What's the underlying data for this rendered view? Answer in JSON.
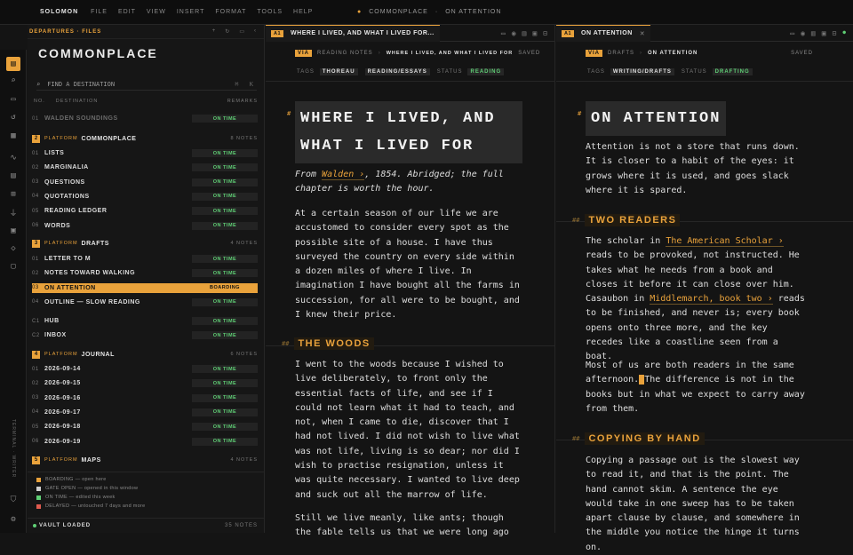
{
  "menubar": {
    "brand": "SOLOMON",
    "items": [
      "FILE",
      "EDIT",
      "VIEW",
      "INSERT",
      "FORMAT",
      "TOOLS",
      "HELP"
    ],
    "center_left": "COMMONPLACE",
    "center_sep": "·",
    "center_right": "ON ATTENTION"
  },
  "rail": {
    "icons": [
      "files-icon",
      "search-icon",
      "inbox-icon",
      "history-icon",
      "grid-icon",
      "activity-icon",
      "table-icon",
      "plugins-icon",
      "plug-icon",
      "archive-icon",
      "tag-icon",
      "calendar-icon",
      "shield-icon",
      "settings-icon"
    ],
    "vertical_label": "TERMINAL · WRITER"
  },
  "sidebar": {
    "header": "DEPARTURES · FILES",
    "title": "COMMONPLACE",
    "search_placeholder": "FIND A DESTINATION",
    "search_kbd": "⌘ K",
    "col_no": "NO.",
    "col_dest": "DESTINATION",
    "col_remarks": "REMARKS",
    "faded_row": {
      "num": "01",
      "name": "WALDEN SOUNDINGS",
      "status": "ON TIME"
    },
    "platforms": [
      {
        "badge": "2",
        "kw": "PLATFORM",
        "name": "COMMONPLACE",
        "count": "8 NOTES"
      },
      {
        "badge": "3",
        "kw": "PLATFORM",
        "name": "DRAFTS",
        "count": "4 NOTES"
      },
      {
        "badge": "4",
        "kw": "PLATFORM",
        "name": "JOURNAL",
        "count": "6 NOTES"
      },
      {
        "badge": "5",
        "kw": "PLATFORM",
        "name": "MAPS",
        "count": "4 NOTES"
      }
    ],
    "commonplace_rows": [
      {
        "num": "01",
        "name": "LISTS",
        "status": "ON TIME"
      },
      {
        "num": "02",
        "name": "MARGINALIA",
        "status": "ON TIME"
      },
      {
        "num": "03",
        "name": "QUESTIONS",
        "status": "ON TIME"
      },
      {
        "num": "04",
        "name": "QUOTATIONS",
        "status": "ON TIME"
      },
      {
        "num": "05",
        "name": "READING LEDGER",
        "status": "ON TIME"
      },
      {
        "num": "06",
        "name": "WORDS",
        "status": "ON TIME"
      }
    ],
    "drafts_rows": [
      {
        "num": "01",
        "name": "LETTER TO M",
        "status": "ON TIME"
      },
      {
        "num": "02",
        "name": "NOTES TOWARD WALKING",
        "status": "ON TIME"
      },
      {
        "num": "03",
        "name": "ON ATTENTION",
        "status": "BOARDING"
      },
      {
        "num": "04",
        "name": "OUTLINE — SLOW READING",
        "status": "ON TIME"
      }
    ],
    "loose_rows": [
      {
        "num": "C1",
        "name": "HUB",
        "status": "ON TIME"
      },
      {
        "num": "C2",
        "name": "INBOX",
        "status": "ON TIME"
      }
    ],
    "journal_rows": [
      {
        "num": "01",
        "name": "2026-09-14",
        "status": "ON TIME"
      },
      {
        "num": "02",
        "name": "2026-09-15",
        "status": "ON TIME"
      },
      {
        "num": "03",
        "name": "2026-09-16",
        "status": "ON TIME"
      },
      {
        "num": "04",
        "name": "2026-09-17",
        "status": "ON TIME"
      },
      {
        "num": "05",
        "name": "2026-09-18",
        "status": "ON TIME"
      },
      {
        "num": "06",
        "name": "2026-09-19",
        "status": "ON TIME"
      }
    ],
    "legend": [
      {
        "label": "BOARDING — open here",
        "color": "#e9a23b"
      },
      {
        "label": "GATE OPEN — opened in this window",
        "color": "#cfcfcf"
      },
      {
        "label": "ON TIME — edited this week",
        "color": "#5fcf75"
      },
      {
        "label": "DELAYED — untouched 7 days and more",
        "color": "#e05a4f"
      }
    ],
    "footer_status": "VAULT LOADED",
    "footer_count": "35 NOTES"
  },
  "pane_left": {
    "tab_badge": "A1",
    "tab_title": "WHERE I LIVED, AND WHAT I LIVED FOR...",
    "via": "VIA",
    "crumb1": "READING NOTES",
    "crumb_sep": "›",
    "crumb2": "WHERE I LIVED, AND WHAT I LIVED FOR",
    "saved": "SAVED",
    "tags_label": "TAGS",
    "tag1": "THOREAU",
    "tag2": "READING/ESSAYS",
    "status_label": "STATUS",
    "status": "READING",
    "h_mark": "#",
    "title_line1": "WHERE I LIVED, AND",
    "title_line2": "WHAT I LIVED FOR",
    "intro_pre": "From ",
    "intro_link": "Walden ›",
    "intro_post": ", 1854. Abridged; the full chapter is worth the hour.",
    "p1": "At a certain season of our life we are accustomed to consider every spot as the possible site of a house. I have thus surveyed the country on every side within a dozen miles of where I live. In imagination I have bought all the farms in succession, for all were to be bought, and I knew their price.",
    "h2_mark": "##",
    "h2": "THE WOODS",
    "p2": "I went to the woods because I wished to live deliberately, to front only the essential facts of life, and see if I could not learn what it had to teach, and not, when I came to die, discover that I had not lived. I did not wish to live what was not life, living is so dear; nor did I wish to practise resignation, unless it was quite necessary. I wanted to live deep and suck out all the marrow of life.",
    "p3": "Still we live meanly, like ants; though the fable tells us that we were long ago"
  },
  "pane_right": {
    "tab_badge": "A1",
    "tab_title": "ON ATTENTION",
    "via": "VIA",
    "crumb1": "DRAFTS",
    "crumb_sep": "›",
    "crumb2": "ON ATTENTION",
    "saved": "SAVED",
    "tags_label": "TAGS",
    "tag1": "WRITING/DRAFTS",
    "status_label": "STATUS",
    "status": "DRAFTING",
    "h_mark": "#",
    "title": "ON ATTENTION",
    "p1": "Attention is not a store that runs down. It is closer to a habit of the eyes: it grows where it is used, and goes slack where it is spared.",
    "h2a_mark": "##",
    "h2a": "TWO READERS",
    "p2_pre": "The scholar in ",
    "p2_link1": "The American Scholar ›",
    "p2_mid": " reads to be provoked, not instructed. He takes what he needs from a book and closes it before it can close over him. Casaubon in ",
    "p2_link2": "Middlemarch, book two ›",
    "p2_post": " reads to be finished, and never is; every book opens onto three more, and the key recedes like a coastline seen from a boat.",
    "p3_pre": "Most of us are both readers in the same afternoon.",
    "p3_post": "The difference is not in the books but in what we expect to carry away from them.",
    "h2b_mark": "##",
    "h2b": "COPYING BY HAND",
    "p4": "Copying a passage out is the slowest way to read it, and that is the point. The hand cannot skim. A sentence the eye would take in one sweep has to be taken apart clause by clause, and somewhere in the middle you notice the hinge it turns on."
  }
}
